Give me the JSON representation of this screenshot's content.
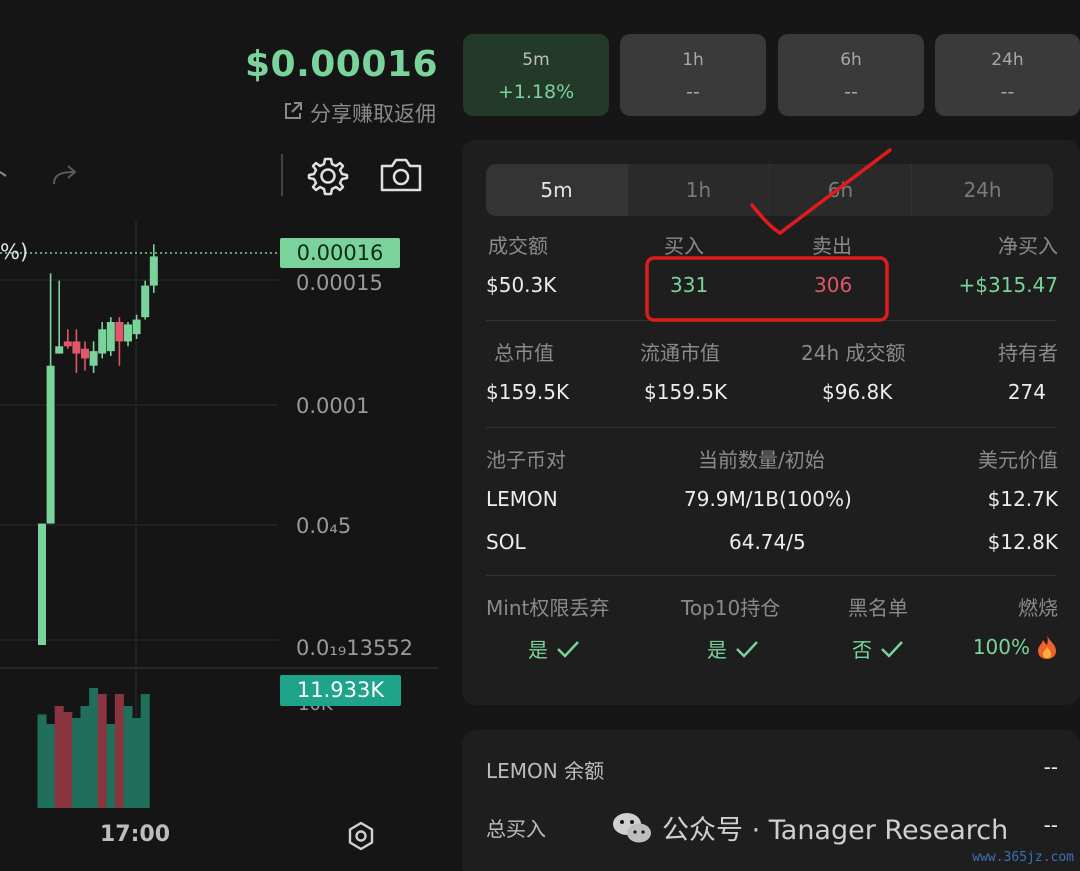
{
  "header": {
    "price": "$0.00016",
    "share_label": "分享赚取返佣"
  },
  "chart": {
    "left_label_fragment": "%)",
    "current_price_tag": "0.00016",
    "volume_tag": "11.933K",
    "volume_axis_label": "10K",
    "time_label": "17:00"
  },
  "chart_data": {
    "type": "candlestick",
    "y_tick_labels": [
      "0.00015",
      "0.0001",
      "0.0₄5",
      "0.0₁₉13552"
    ],
    "x_tick_labels": [
      "17:00"
    ],
    "current_price": "0.00016",
    "current_volume": "11.933K",
    "candles": [
      {
        "dir": "up",
        "open": 0.0,
        "close": 5e-05,
        "low": 0.0,
        "high": 5e-05
      },
      {
        "dir": "up",
        "open": 5e-05,
        "close": 0.000115,
        "low": 5e-05,
        "high": 0.000153
      },
      {
        "dir": "up",
        "open": 0.00012,
        "close": 0.000123,
        "low": 0.00012,
        "high": 0.00015
      },
      {
        "dir": "down",
        "open": 0.000125,
        "close": 0.000123,
        "low": 0.000122,
        "high": 0.00013
      },
      {
        "dir": "down",
        "open": 0.000125,
        "close": 0.00012,
        "low": 0.000112,
        "high": 0.00013
      },
      {
        "dir": "down",
        "open": 0.000122,
        "close": 0.000118,
        "low": 0.000113,
        "high": 0.000125
      },
      {
        "dir": "up",
        "open": 0.000115,
        "close": 0.000121,
        "low": 0.000112,
        "high": 0.000125
      },
      {
        "dir": "up",
        "open": 0.00012,
        "close": 0.00013,
        "low": 0.000118,
        "high": 0.000133
      },
      {
        "dir": "up",
        "open": 0.000121,
        "close": 0.000133,
        "low": 0.000119,
        "high": 0.000135
      },
      {
        "dir": "down",
        "open": 0.000133,
        "close": 0.000125,
        "low": 0.000115,
        "high": 0.000135
      },
      {
        "dir": "up",
        "open": 0.000125,
        "close": 0.000132,
        "low": 0.000123,
        "high": 0.000133
      },
      {
        "dir": "up",
        "open": 0.000128,
        "close": 0.000134,
        "low": 0.000126,
        "high": 0.000136
      },
      {
        "dir": "up",
        "open": 0.000135,
        "close": 0.000148,
        "low": 0.000134,
        "high": 0.00015
      },
      {
        "dir": "up",
        "open": 0.000148,
        "close": 0.00016,
        "low": 0.000145,
        "high": 0.000165
      }
    ],
    "volumes": [
      {
        "dir": "up",
        "v": 0.78
      },
      {
        "dir": "up",
        "v": 0.7
      },
      {
        "dir": "down",
        "v": 0.85
      },
      {
        "dir": "down",
        "v": 0.8
      },
      {
        "dir": "up",
        "v": 0.75
      },
      {
        "dir": "up",
        "v": 0.85
      },
      {
        "dir": "up",
        "v": 1.0
      },
      {
        "dir": "down",
        "v": 0.95
      },
      {
        "dir": "up",
        "v": 0.7
      },
      {
        "dir": "down",
        "v": 0.95
      },
      {
        "dir": "up",
        "v": 0.85
      },
      {
        "dir": "up",
        "v": 0.75
      },
      {
        "dir": "up",
        "v": 0.95
      }
    ]
  },
  "timeframes": [
    {
      "label": "5m",
      "value": "+1.18%",
      "active": true
    },
    {
      "label": "1h",
      "value": "--",
      "active": false
    },
    {
      "label": "6h",
      "value": "--",
      "active": false
    },
    {
      "label": "24h",
      "value": "--",
      "active": false
    }
  ],
  "tabs": [
    "5m",
    "1h",
    "6h",
    "24h"
  ],
  "trade_stats": {
    "headers": [
      "成交额",
      "买入",
      "卖出",
      "净买入"
    ],
    "values": [
      "$50.3K",
      "331",
      "306",
      "+$315.47"
    ]
  },
  "market_stats": {
    "headers": [
      "总市值",
      "流通市值",
      "24h 成交额",
      "持有者"
    ],
    "values": [
      "$159.5K",
      "$159.5K",
      "$96.8K",
      "274"
    ]
  },
  "pool": {
    "headers": [
      "池子币对",
      "当前数量/初始",
      "美元价值"
    ],
    "rows": [
      {
        "pair": "LEMON",
        "amount": "79.9M/1B(100%)",
        "usd": "$12.7K"
      },
      {
        "pair": "SOL",
        "amount": "64.74/5",
        "usd": "$12.8K"
      }
    ]
  },
  "security": {
    "headers": [
      "Mint权限丢弃",
      "Top10持仓",
      "黑名单",
      "燃烧"
    ],
    "values": [
      "是",
      "是",
      "否",
      "100%"
    ]
  },
  "balance": {
    "title": "LEMON 余额",
    "title_value": "--",
    "total_buy_label": "总买入",
    "total_buy_value": "--"
  },
  "watermark": {
    "text": "公众号 · Tanager Research",
    "site": "www.365jz.com"
  },
  "colors": {
    "up": "#7ad39a",
    "down": "#e0566b",
    "annotation": "#e01b1b"
  }
}
